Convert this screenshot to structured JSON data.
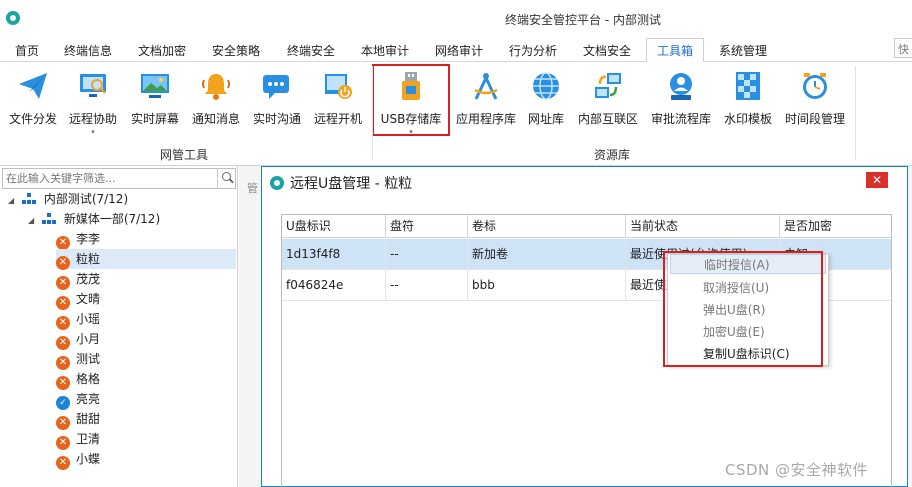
{
  "window": {
    "title": "终端安全管控平台 - 内部测试"
  },
  "menu": {
    "tabs": [
      "首页",
      "终端信息",
      "文档加密",
      "安全策略",
      "终端安全",
      "本地审计",
      "网络审计",
      "行为分析",
      "文档安全",
      "工具箱",
      "系统管理"
    ],
    "active": "工具箱",
    "quick_search": "快"
  },
  "ribbon": {
    "buttons": [
      {
        "label": "文件分发",
        "icon": "paper-plane-icon"
      },
      {
        "label": "远程协助",
        "icon": "remote-assist-icon",
        "dropdown": "▾"
      },
      {
        "label": "实时屏幕",
        "icon": "monitor-icon"
      },
      {
        "label": "通知消息",
        "icon": "bell-icon"
      },
      {
        "label": "实时沟通",
        "icon": "chat-icon"
      },
      {
        "label": "远程开机",
        "icon": "power-on-icon"
      },
      {
        "label": "USB存储库",
        "icon": "usb-icon",
        "dropdown": "▾"
      },
      {
        "label": "应用程序库",
        "icon": "compass-icon"
      },
      {
        "label": "网址库",
        "icon": "globe-icon"
      },
      {
        "label": "内部互联区",
        "icon": "network-icon"
      },
      {
        "label": "审批流程库",
        "icon": "approval-icon"
      },
      {
        "label": "水印模板",
        "icon": "watermark-icon"
      },
      {
        "label": "时间段管理",
        "icon": "clock-icon"
      }
    ],
    "groups": [
      "网管工具",
      "资源库"
    ]
  },
  "left_panel": {
    "search_placeholder": "在此输入关键字筛选...",
    "root": "内部测试(7/12)",
    "dept": "新媒体一部(7/12)",
    "users": [
      {
        "name": "李李",
        "status": "offline"
      },
      {
        "name": "粒粒",
        "status": "offline",
        "selected": true
      },
      {
        "name": "茂茂",
        "status": "offline"
      },
      {
        "name": "文晴",
        "status": "offline"
      },
      {
        "name": "小瑶",
        "status": "offline"
      },
      {
        "name": "小月",
        "status": "offline"
      },
      {
        "name": "测试",
        "status": "offline"
      },
      {
        "name": "格格",
        "status": "offline"
      },
      {
        "name": "亮亮",
        "status": "online"
      },
      {
        "name": "甜甜",
        "status": "offline"
      },
      {
        "name": "卫清",
        "status": "offline"
      },
      {
        "name": "小蝶",
        "status": "offline"
      }
    ],
    "status_glyphs": {
      "offline": "✕",
      "online": "✓"
    },
    "right_label": "管"
  },
  "dialog": {
    "title": "远程U盘管理 - 粒粒",
    "close": "✕",
    "columns": [
      "U盘标识",
      "盘符",
      "卷标",
      "当前状态",
      "是否加密"
    ],
    "rows": [
      {
        "id": "1d13f4f8",
        "drive": "--",
        "label": "新加卷",
        "status": "最近使用过(允许使用)",
        "encrypted": "未知"
      },
      {
        "id": "f046824e",
        "drive": "--",
        "label": "bbb",
        "status": "最近使用过",
        "encrypted": ""
      }
    ]
  },
  "context_menu": {
    "items": [
      "临时授信(A)",
      "取消授信(U)",
      "弹出U盘(R)",
      "加密U盘(E)",
      "复制U盘标识(C)"
    ]
  },
  "watermark": "CSDN @安全神软件",
  "colors": {
    "accent": "#1a6fc4",
    "highlight_red": "#d62020",
    "offline": "#e8641b",
    "online": "#1a85d6"
  }
}
